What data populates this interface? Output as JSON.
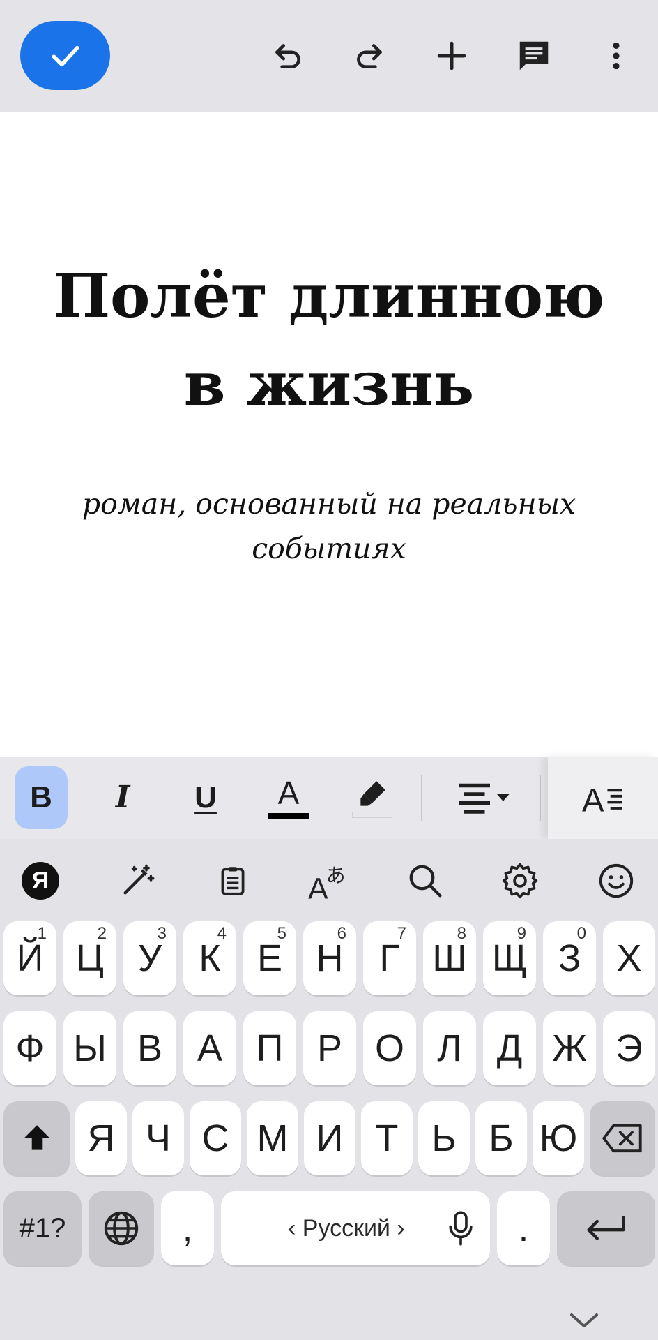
{
  "document": {
    "title": "Полёт длинною в жизнь",
    "subtitle": "роман, основанный на реальных событиях"
  },
  "colors": {
    "accent": "#1a73e8",
    "bold_active": "#aec8fa",
    "toolbar_bg": "#e4e4e8",
    "keyboard_bg": "#e3e3e7"
  },
  "topbar": {
    "icons": [
      "check-icon",
      "undo-icon",
      "redo-icon",
      "plus-icon",
      "comment-icon",
      "more-vert-icon"
    ]
  },
  "format_toolbar": {
    "bold": "B",
    "italic": "I",
    "underline": "U",
    "text_color": "A",
    "text_color_value": "#000000"
  },
  "keyboard": {
    "suggestion_icons": [
      "yandex-icon",
      "magic-wand-icon",
      "clipboard-icon",
      "translate-icon",
      "search-icon",
      "settings-icon",
      "emoji-icon"
    ],
    "yandex_label": "Я",
    "row1": [
      {
        "ch": "Й",
        "hint": "1"
      },
      {
        "ch": "Ц",
        "hint": "2"
      },
      {
        "ch": "У",
        "hint": "3"
      },
      {
        "ch": "К",
        "hint": "4"
      },
      {
        "ch": "Е",
        "hint": "5"
      },
      {
        "ch": "Н",
        "hint": "6"
      },
      {
        "ch": "Г",
        "hint": "7"
      },
      {
        "ch": "Ш",
        "hint": "8"
      },
      {
        "ch": "Щ",
        "hint": "9"
      },
      {
        "ch": "З",
        "hint": "0"
      },
      {
        "ch": "Х",
        "hint": ""
      }
    ],
    "row2": [
      "Ф",
      "Ы",
      "В",
      "А",
      "П",
      "Р",
      "О",
      "Л",
      "Д",
      "Ж",
      "Э"
    ],
    "row3": [
      "Я",
      "Ч",
      "С",
      "М",
      "И",
      "Т",
      "Ь",
      "Б",
      "Ю"
    ],
    "symbols_label": "#1?",
    "comma": ",",
    "period": ".",
    "space_label": "‹ Русский ›"
  }
}
